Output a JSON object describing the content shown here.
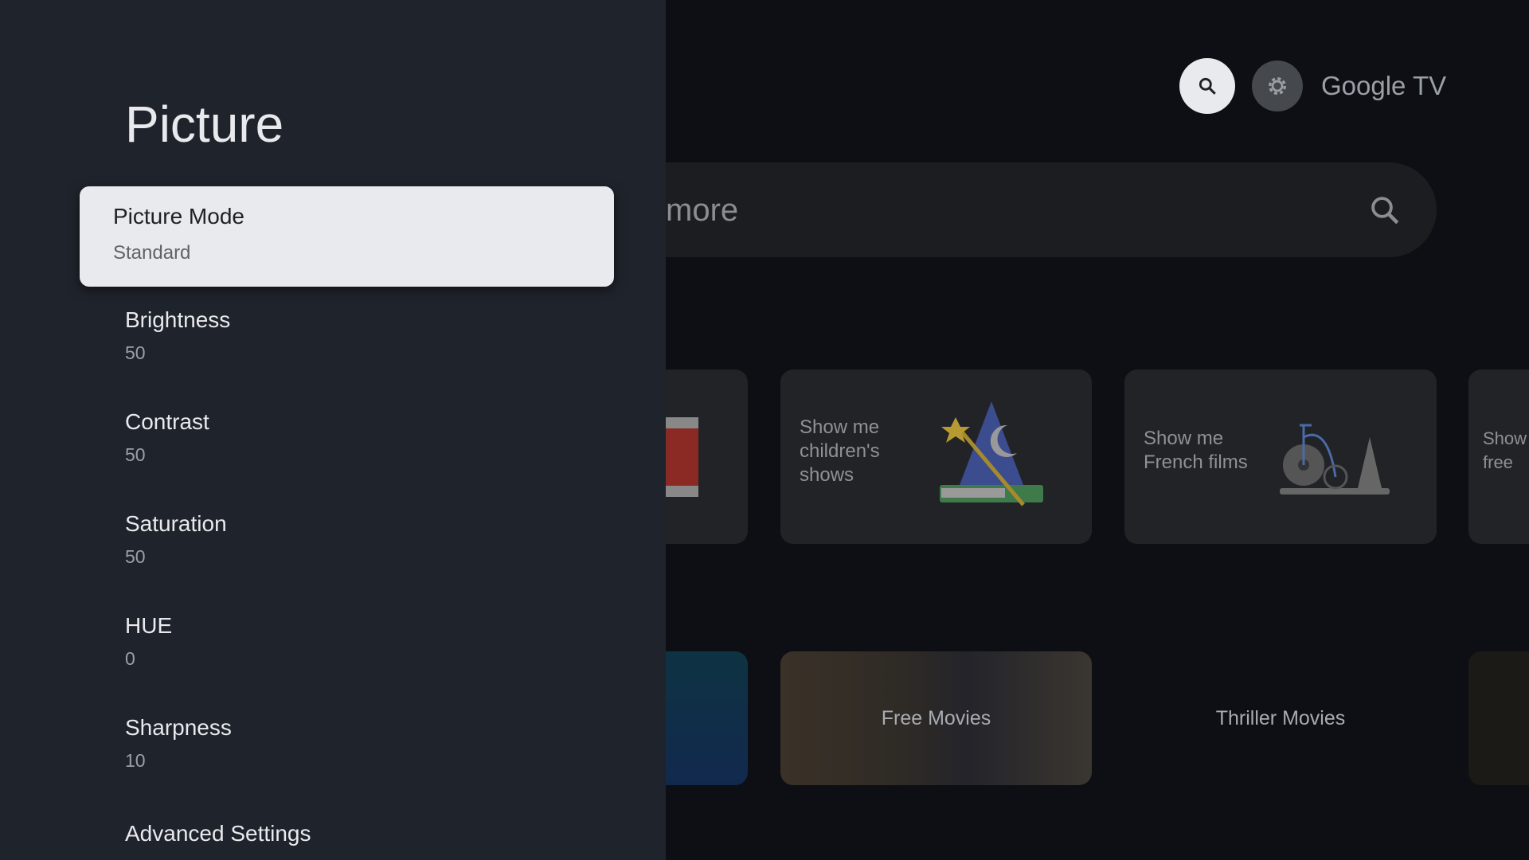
{
  "header": {
    "brand": "Google TV",
    "search_icon": "search-icon",
    "settings_icon": "gear-icon"
  },
  "search_bar": {
    "text": "more",
    "icon": "search-icon"
  },
  "suggestions": [
    {
      "lines": []
    },
    {
      "lines": [
        "Show me",
        "children's",
        "shows"
      ]
    },
    {
      "lines": [
        "Show me",
        "French films"
      ]
    },
    {
      "lines": [
        "Show",
        "free"
      ]
    }
  ],
  "collections": [
    "",
    "Free Movies",
    "Thriller Movies",
    ""
  ],
  "panel": {
    "title": "Picture",
    "selected": {
      "label": "Picture Mode",
      "value": "Standard"
    },
    "items": [
      {
        "label": "Brightness",
        "value": "50"
      },
      {
        "label": "Contrast",
        "value": "50"
      },
      {
        "label": "Saturation",
        "value": "50"
      },
      {
        "label": "HUE",
        "value": "0"
      },
      {
        "label": "Sharpness",
        "value": "10"
      },
      {
        "label": "Advanced Settings"
      }
    ]
  }
}
